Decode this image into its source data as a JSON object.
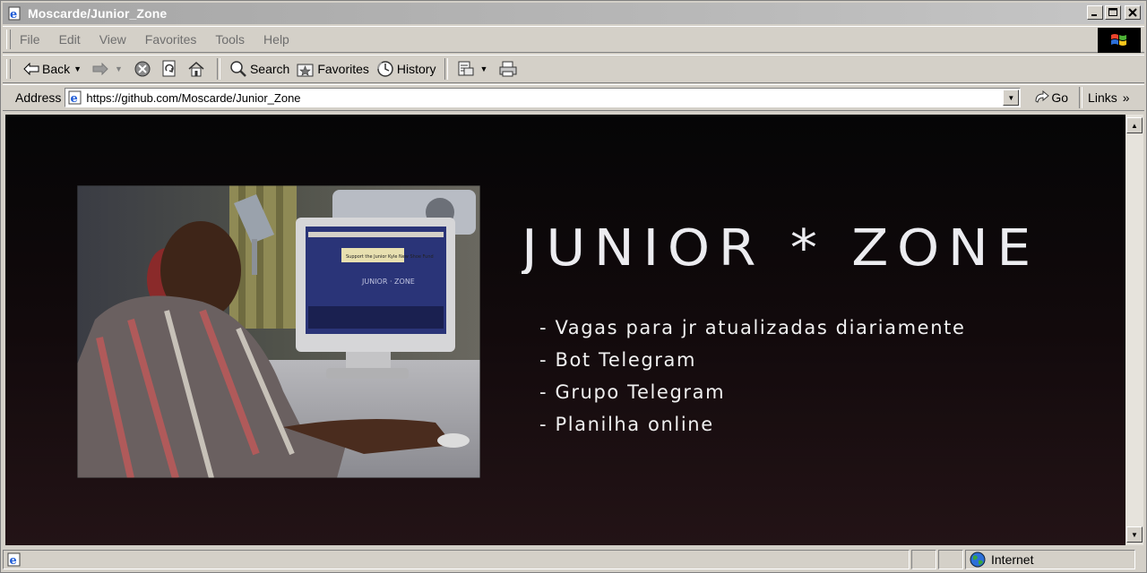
{
  "window": {
    "title": "Moscarde/Junior_Zone"
  },
  "menu": {
    "items": [
      "File",
      "Edit",
      "View",
      "Favorites",
      "Tools",
      "Help"
    ]
  },
  "toolbar": {
    "back_label": "Back",
    "search_label": "Search",
    "favorites_label": "Favorites",
    "history_label": "History"
  },
  "address": {
    "label": "Address",
    "url": "https://github.com/Moscarde/Junior_Zone",
    "go_label": "Go",
    "links_label": "Links"
  },
  "page": {
    "logo_text": "JUNIOR * ZONE",
    "features": [
      "- Vagas para jr atualizadas diariamente",
      "- Bot Telegram",
      "- Grupo Telegram",
      "- Planilha online"
    ],
    "screen_inset_text": "Support the Junior Kyle New Shoe Fund",
    "screen_inset_logo": "JUNIOR · ZONE"
  },
  "status": {
    "zone_label": "Internet"
  },
  "colors": {
    "titlebar": "#b0b0b0",
    "chrome": "#d4d0c8",
    "page_bg_top": "#050506",
    "page_bg_bottom": "#231316",
    "text_light": "#f0f0f0"
  }
}
